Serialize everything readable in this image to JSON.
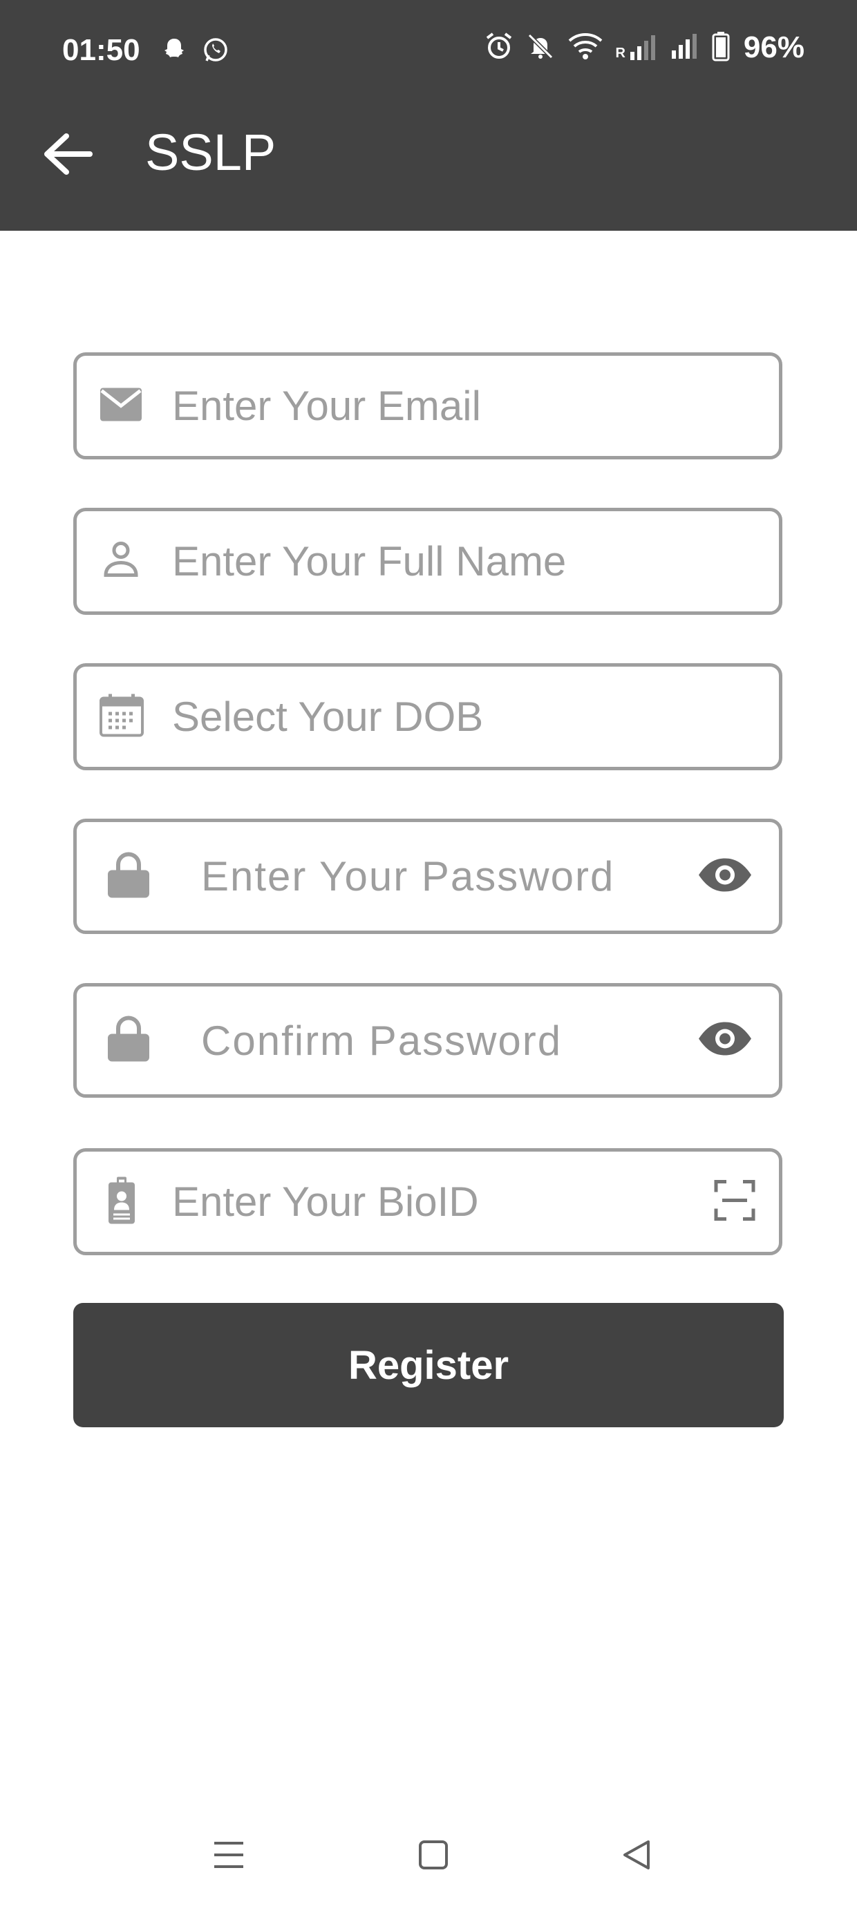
{
  "status_bar": {
    "time": "01:50",
    "battery_percent": "96%",
    "network_roaming_label": "R",
    "icons": [
      "snapchat-icon",
      "whatsapp-icon",
      "alarm-icon",
      "mute-icon",
      "wifi-icon",
      "signal-icon",
      "signal-icon",
      "battery-icon"
    ]
  },
  "app_bar": {
    "title": "SSLP",
    "back_icon": "arrow-left-icon"
  },
  "form": {
    "email": {
      "placeholder": "Enter Your Email",
      "value": "",
      "icon": "mail-icon"
    },
    "full_name": {
      "placeholder": "Enter Your Full Name",
      "value": "",
      "icon": "person-icon"
    },
    "dob": {
      "placeholder": "Select Your DOB",
      "value": "",
      "icon": "calendar-icon"
    },
    "password": {
      "placeholder": "Enter Your Password",
      "value": "",
      "icon": "lock-icon",
      "toggle_icon": "eye-icon"
    },
    "confirm_password": {
      "placeholder": "Confirm Password",
      "value": "",
      "icon": "lock-icon",
      "toggle_icon": "eye-icon"
    },
    "bio_id": {
      "placeholder": "Enter Your BioID",
      "value": "",
      "icon": "id-badge-icon",
      "scan_icon": "scan-icon"
    },
    "register_label": "Register"
  },
  "nav_bar": {
    "buttons": [
      "menu-icon",
      "home-square-icon",
      "back-triangle-icon"
    ]
  },
  "colors": {
    "header": "#424242",
    "field_border": "#9e9e9e",
    "placeholder": "#9e9e9e",
    "button": "#424242",
    "background": "#ffffff"
  }
}
